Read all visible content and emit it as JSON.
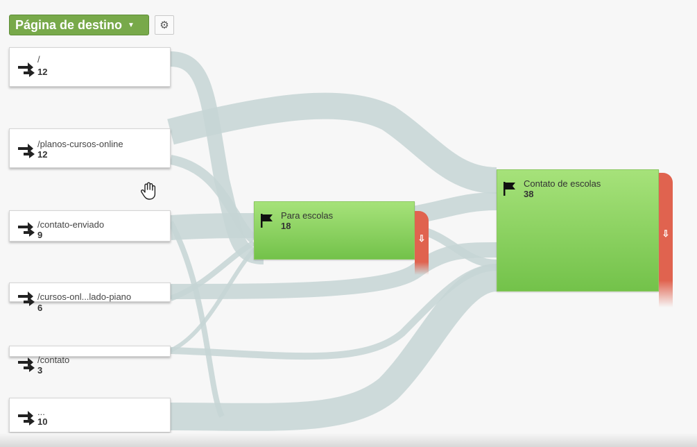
{
  "header": {
    "dimension_label": "Página de destino",
    "caret_icon": "caret-down-icon",
    "settings_icon": "gear-icon"
  },
  "sources": [
    {
      "label": "/",
      "count": "12",
      "icon": "entrance-arrows-icon"
    },
    {
      "label": "/planos-cursos-online",
      "count": "12",
      "icon": "entrance-arrows-icon"
    },
    {
      "label": "/contato-enviado",
      "count": "9",
      "icon": "entrance-arrows-icon"
    },
    {
      "label": "/cursos-onl...lado-piano",
      "count": "6",
      "icon": "entrance-arrows-icon"
    },
    {
      "label": "/contato",
      "count": "3",
      "icon": "entrance-arrows-icon"
    },
    {
      "label": "...",
      "count": "10",
      "icon": "entrance-arrows-icon"
    }
  ],
  "goals": [
    {
      "label": "Para escolas",
      "count": "18",
      "icon": "flag-icon"
    },
    {
      "label": "Contato de escolas",
      "count": "38",
      "icon": "flag-icon"
    }
  ],
  "dropoff_icon": "down-arrow-icon",
  "cursor_icon": "hand-cursor-icon",
  "colors": {
    "button_green": "#78a94a",
    "goal_green_top": "#a6e27a",
    "goal_green_bottom": "#73c24a",
    "dropoff_red": "#e0634f",
    "flow": "#c5d5d5"
  }
}
